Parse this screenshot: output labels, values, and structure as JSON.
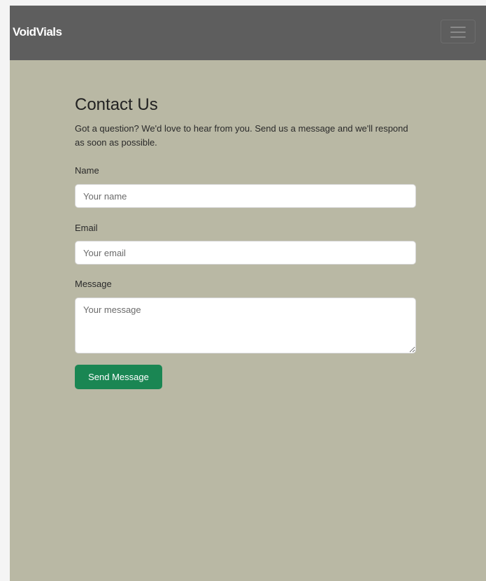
{
  "navbar": {
    "brand": "VoidVials",
    "toggle_icon": "hamburger-menu-icon"
  },
  "contact": {
    "title": "Contact Us",
    "intro": "Got a question? We'd love to hear from you. Send us a message and we'll respond as soon as possible.",
    "name_label": "Name",
    "name_placeholder": "Your name",
    "name_value": "",
    "email_label": "Email",
    "email_placeholder": "Your email",
    "email_value": "",
    "message_label": "Message",
    "message_placeholder": "Your message",
    "message_value": "",
    "submit_label": "Send Message"
  },
  "colors": {
    "navbar_bg": "#5e5e5e",
    "page_bg": "#b9b8a4",
    "button_bg": "#1a8653",
    "text": "#222222"
  }
}
